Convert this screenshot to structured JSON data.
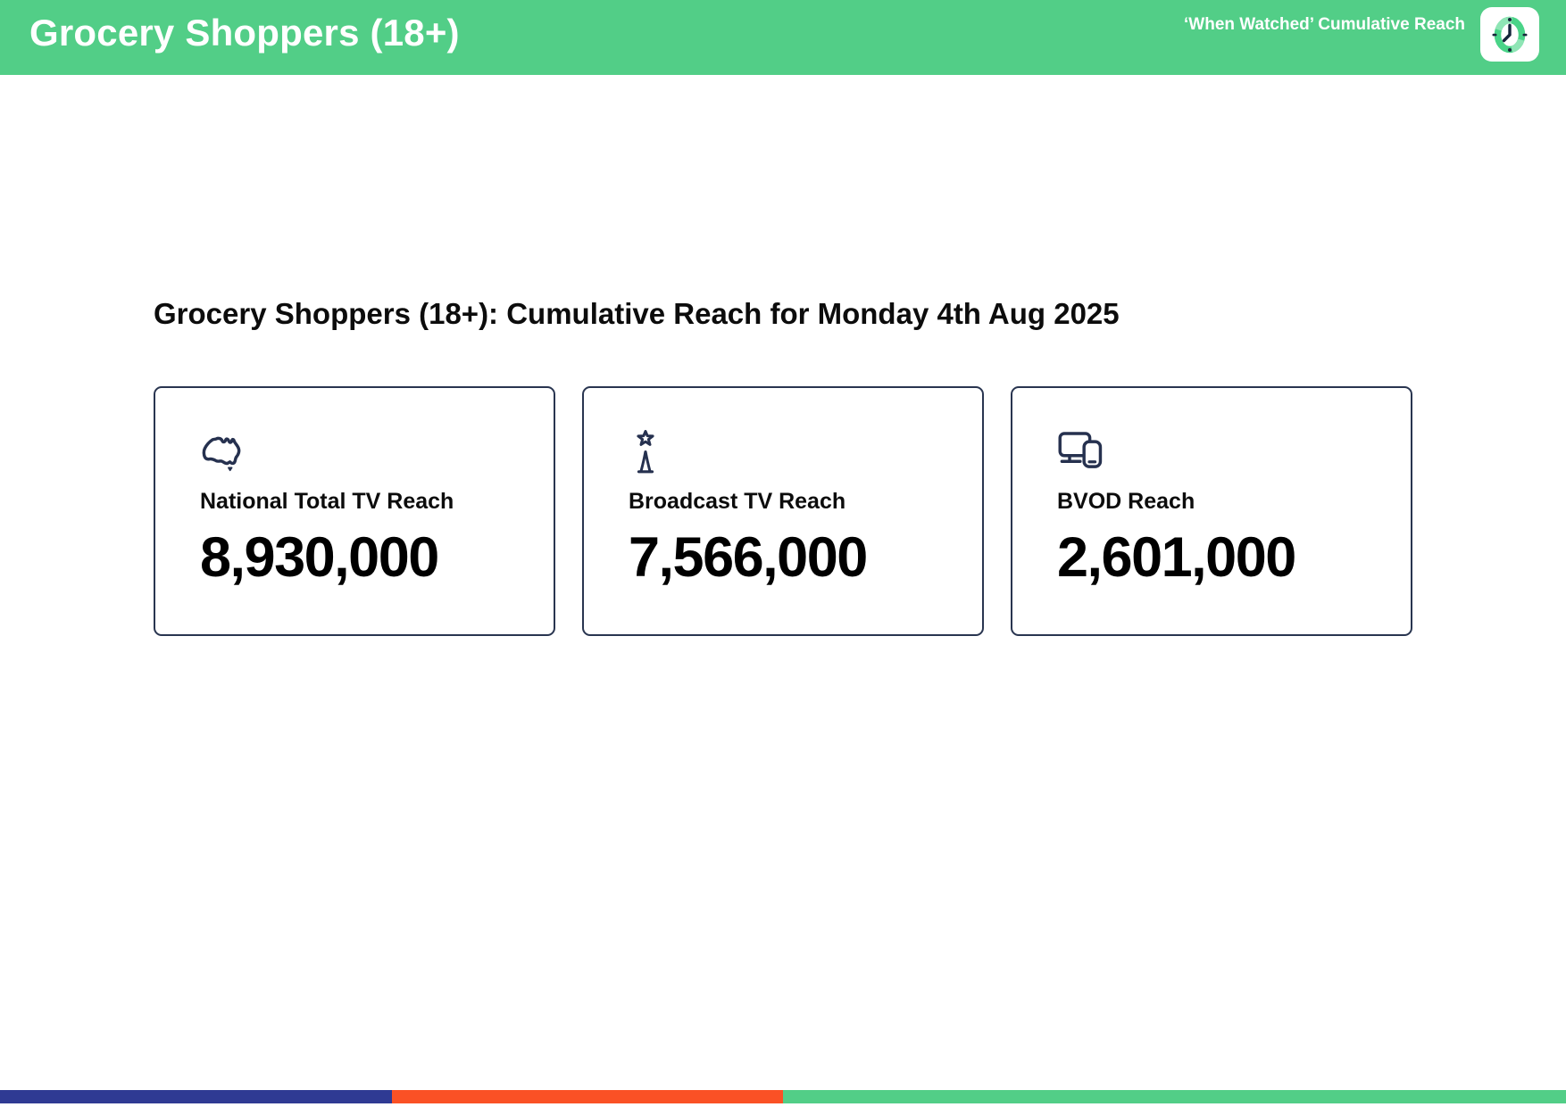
{
  "header": {
    "title": "Grocery Shoppers (18+)",
    "subtitle": "‘When Watched’ Cumulative Reach",
    "logo_icon": "clock-logo-icon",
    "background_color": "#52CE87"
  },
  "main": {
    "heading": "Grocery Shoppers (18+): Cumulative Reach for Monday 4th Aug 2025",
    "cards": [
      {
        "icon": "australia-map-icon",
        "label": "National Total TV Reach",
        "value": "8,930,000"
      },
      {
        "icon": "broadcast-tower-icon",
        "label": "Broadcast TV Reach",
        "value": "7,566,000"
      },
      {
        "icon": "tv-devices-icon",
        "label": "BVOD Reach",
        "value": "2,601,000"
      }
    ]
  },
  "footer": {
    "segments": [
      {
        "name": "blue",
        "color": "#2F3A93",
        "width_pct": 25
      },
      {
        "name": "orange",
        "color": "#FA5125",
        "width_pct": 25
      },
      {
        "name": "green",
        "color": "#52CE87",
        "width_pct": 50
      }
    ]
  },
  "colors": {
    "accent_green": "#52CE87",
    "icon_navy": "#26314F",
    "card_border": "#293550",
    "text": "#0c0c0c"
  }
}
